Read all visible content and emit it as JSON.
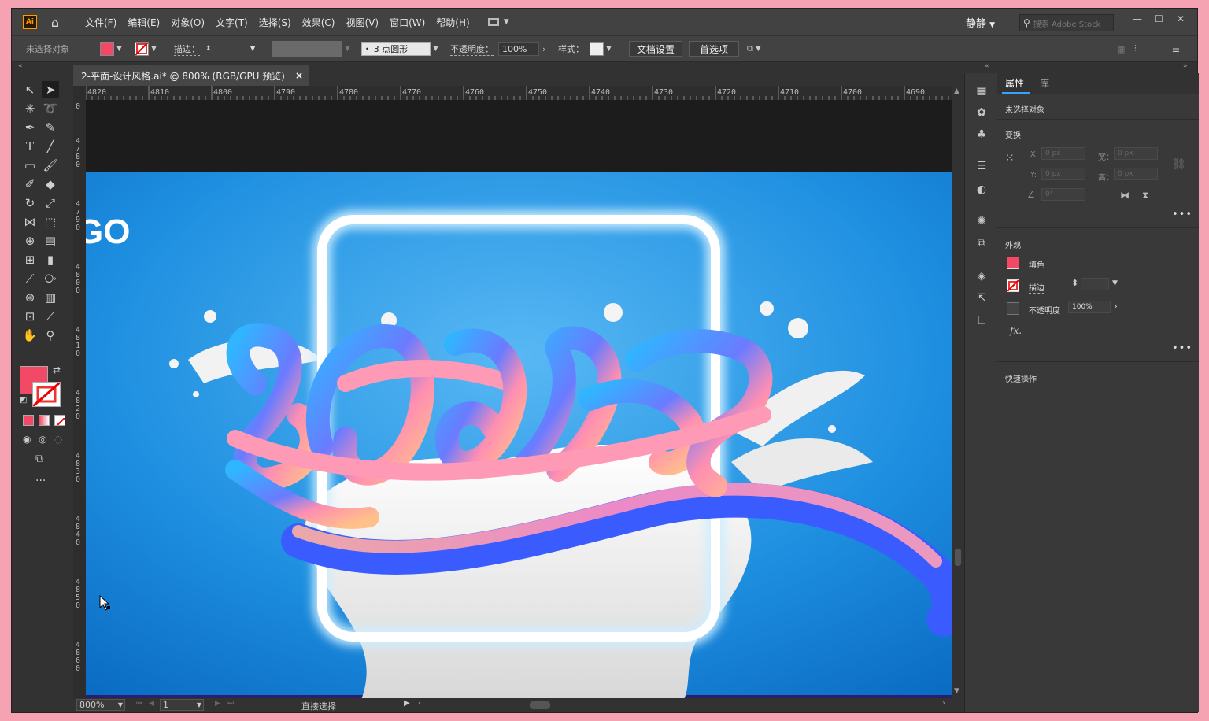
{
  "menubar": {
    "app_icon": "Ai",
    "home_icon": "home-icon",
    "items": [
      "文件(F)",
      "编辑(E)",
      "对象(O)",
      "文字(T)",
      "选择(S)",
      "效果(C)",
      "视图(V)",
      "窗口(W)",
      "帮助(H)"
    ],
    "user": "静静",
    "search_placeholder": "搜索 Adobe Stock"
  },
  "control_bar": {
    "selection_status": "未选择对象",
    "stroke_label": "描边：",
    "brush_label": "3 点圆形",
    "opacity_label": "不透明度：",
    "opacity_value": "100%",
    "style_label": "样式：",
    "doc_setup_button": "文档设置",
    "preferences_button": "首选项"
  },
  "document": {
    "tab_title": "2-平面-设计风格.ai* @ 800% (RGB/GPU 预览)",
    "close_glyph": "×"
  },
  "rulers": {
    "horizontal": [
      "4820",
      "4810",
      "4800",
      "4790",
      "4780",
      "4770",
      "4760",
      "4750",
      "4740",
      "4730",
      "4720",
      "4710",
      "4700",
      "4690"
    ],
    "vertical": [
      [
        "0"
      ],
      [
        "4",
        "7",
        "8",
        "0"
      ],
      [
        "4",
        "7",
        "9",
        "0"
      ],
      [
        "4",
        "8",
        "0",
        "0"
      ],
      [
        "4",
        "8",
        "1",
        "0"
      ],
      [
        "4",
        "8",
        "2",
        "0"
      ],
      [
        "4",
        "8",
        "3",
        "0"
      ],
      [
        "4",
        "8",
        "4",
        "0"
      ],
      [
        "4",
        "8",
        "5",
        "0"
      ],
      [
        "4",
        "8",
        "6",
        "0"
      ]
    ]
  },
  "artwork": {
    "partial_text": "GO"
  },
  "status_bar": {
    "zoom": "800%",
    "page": "1",
    "tool_name": "直接选择"
  },
  "properties_panel": {
    "tabs": [
      "属性",
      "库"
    ],
    "selection_status": "未选择对象",
    "transform_section": "变换",
    "x_label": "X:",
    "x_value": "0 px",
    "y_label": "Y:",
    "y_value": "0 px",
    "width_label": "宽：",
    "width_value": "0 px",
    "height_label": "高：",
    "height_value": "0 px",
    "angle_value": "0°",
    "appearance_section": "外观",
    "fill_label": "填色",
    "stroke_label": "描边",
    "opacity_label": "不透明度",
    "opacity_value": "100%",
    "fx_label": "fx.",
    "quick_actions_section": "快速操作"
  },
  "colors": {
    "fill": "#f24a66",
    "canvas_blue": "#1e8fe0",
    "ui_dark": "#323232"
  }
}
